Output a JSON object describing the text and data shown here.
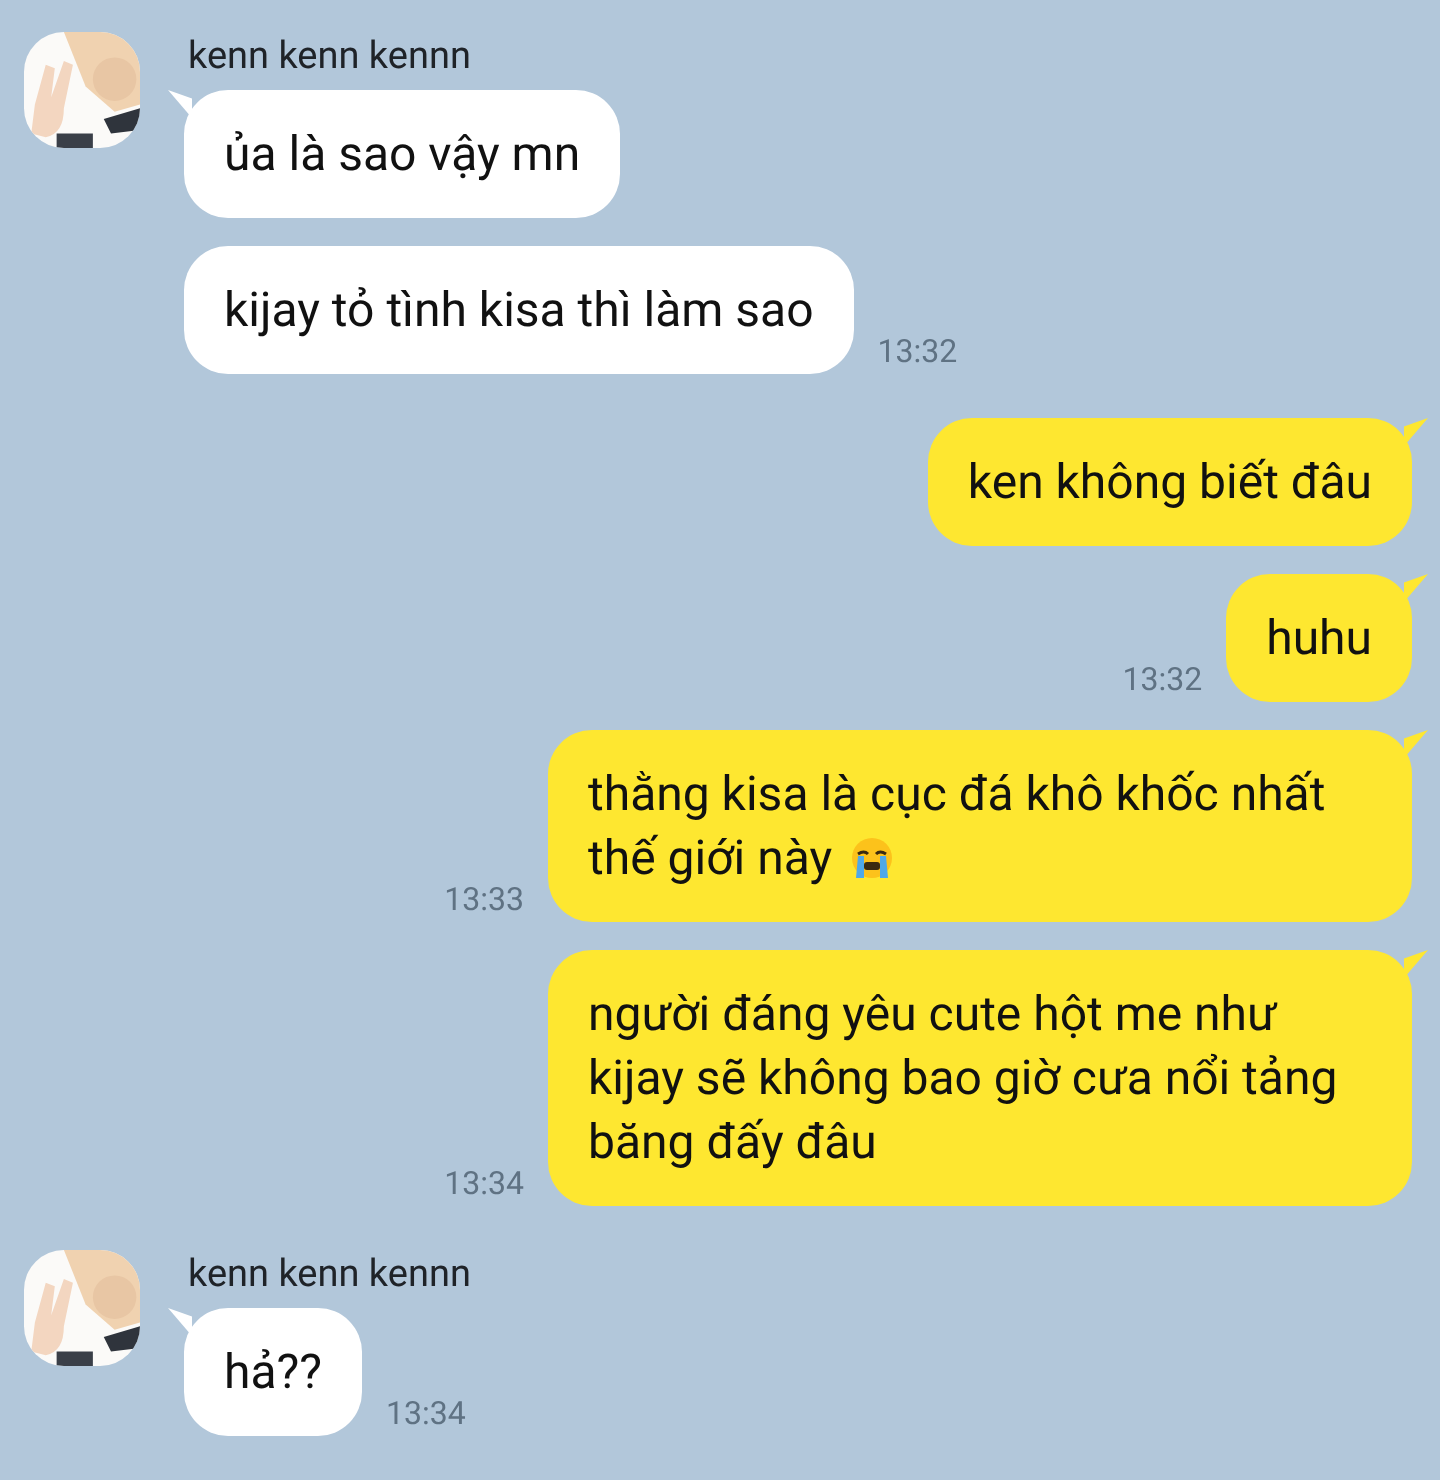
{
  "groups": [
    {
      "kind": "incoming",
      "sender": "kenn kenn kennn",
      "messages": [
        {
          "text": "ủa là sao vậy mn",
          "tail": true
        },
        {
          "text": "kijay tỏ tình kisa thì làm sao",
          "tail": false,
          "time": "13:32"
        }
      ]
    },
    {
      "kind": "outgoing",
      "messages": [
        {
          "text": "ken không biết đâu",
          "tail": true
        },
        {
          "text": "huhu",
          "tail": true,
          "time": "13:32"
        },
        {
          "text": "thằng kisa là cục đá khô khốc nhất thế giới này",
          "tail": true,
          "time": "13:33",
          "trailing_icon": true
        },
        {
          "text": "người đáng yêu cute hột me như kijay sẽ không bao giờ cưa nổi tảng băng đấy đâu",
          "tail": true,
          "time": "13:34"
        }
      ]
    },
    {
      "kind": "incoming",
      "sender": "kenn kenn kennn",
      "messages": [
        {
          "text": "hả??",
          "tail": true,
          "time": "13:34"
        }
      ]
    }
  ]
}
